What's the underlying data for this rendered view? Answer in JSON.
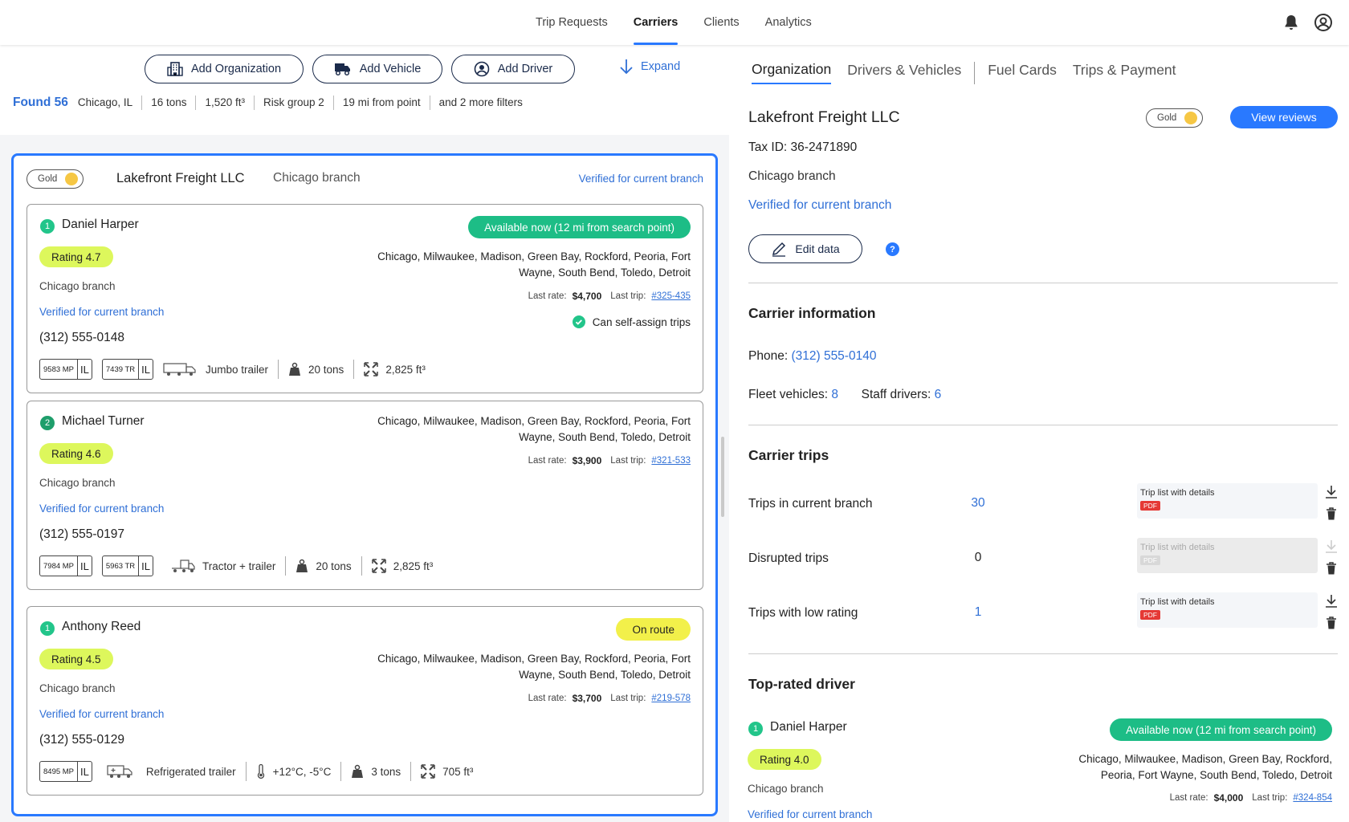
{
  "nav": {
    "items": [
      "Trip Requests",
      "Carriers",
      "Clients",
      "Analytics"
    ],
    "active": "Carriers"
  },
  "toolbar": {
    "add_org": "Add Organization",
    "add_vehicle": "Add Vehicle",
    "add_driver": "Add Driver",
    "expand": "Expand"
  },
  "filters": {
    "found": "Found 56",
    "items": [
      "Chicago, IL",
      "16 tons",
      "1,520 ft³",
      "Risk group 2",
      "19 mi from point",
      "and 2 more filters"
    ]
  },
  "card": {
    "badge": "Gold",
    "org_name": "Lakefront Freight LLC",
    "branch": "Chicago branch",
    "verified": "Verified for current branch"
  },
  "drivers": [
    {
      "num": "1",
      "name": "Daniel Harper",
      "rating": "Rating 4.7",
      "branch": "Chicago branch",
      "verified": "Verified for current branch",
      "phone": "(312) 555-0148",
      "status": "Available now (12 mi from search point)",
      "cities_1": "Chicago, Milwaukee, Madison, Green Bay, Rockford, Peoria, Fort",
      "cities_2": "Wayne, South Bend, Toledo, Detroit",
      "last_rate_label": "Last rate:",
      "last_rate": "$4,700",
      "last_trip_label": "Last trip:",
      "last_trip": "#325-435",
      "self_assign": "Can self-assign trips",
      "plate1": "9583 MP",
      "plate2": "7439 TR",
      "region": "IL",
      "vehicle": "Jumbo trailer",
      "capacity": "20 tons",
      "volume": "2,825 ft³"
    },
    {
      "num": "2",
      "name": "Michael Turner",
      "rating": "Rating 4.6",
      "branch": "Chicago branch",
      "verified": "Verified for current branch",
      "phone": "(312) 555-0197",
      "cities_1": "Chicago, Milwaukee, Madison, Green Bay, Rockford, Peoria, Fort",
      "cities_2": "Wayne, South Bend, Toledo, Detroit",
      "last_rate_label": "Last rate:",
      "last_rate": "$3,900",
      "last_trip_label": "Last trip:",
      "last_trip": "#321-533",
      "plate1": "7984 MP",
      "plate2": "5963 TR",
      "region": "IL",
      "vehicle": "Tractor + trailer",
      "capacity": "20 tons",
      "volume": "2,825 ft³"
    },
    {
      "num": "1",
      "name": "Anthony Reed",
      "rating": "Rating 4.5",
      "branch": "Chicago branch",
      "verified": "Verified for current branch",
      "phone": "(312) 555-0129",
      "status": "On route",
      "cities_1": "Chicago, Milwaukee, Madison, Green Bay, Rockford, Peoria, Fort",
      "cities_2": "Wayne, South Bend, Toledo, Detroit",
      "last_rate_label": "Last rate:",
      "last_rate": "$3,700",
      "last_trip_label": "Last trip:",
      "last_trip": "#219-578",
      "plate1": "8495 MP",
      "region": "IL",
      "vehicle": "Refrigerated trailer",
      "temp": "+12°C, -5°C",
      "capacity": "3 tons",
      "volume": "705 ft³"
    }
  ],
  "right": {
    "tabs": [
      "Organization",
      "Drivers & Vehicles",
      "Fuel Cards",
      "Trips & Payment"
    ],
    "org_name": "Lakefront Freight LLC",
    "badge": "Gold",
    "view_reviews": "View reviews",
    "tax_id": "Tax ID: 36-2471890",
    "branch": "Chicago branch",
    "verified": "Verified for current branch",
    "edit": "Edit data",
    "help": "?",
    "carrier_info": {
      "title": "Carrier information",
      "phone_label": "Phone:",
      "phone": "(312) 555-0140",
      "fleet_label": "Fleet vehicles:",
      "fleet": "8",
      "staff_label": "Staff drivers:",
      "staff": "6"
    },
    "trips": {
      "title": "Carrier trips",
      "rows": [
        {
          "label": "Trips in current branch",
          "value": "30",
          "doc": "Trip list with details",
          "fmt": "PDF"
        },
        {
          "label": "Disrupted trips",
          "value": "0",
          "doc": "Trip list with details",
          "fmt": "PDF"
        },
        {
          "label": "Trips with low rating",
          "value": "1",
          "doc": "Trip list with details",
          "fmt": "PDF"
        }
      ]
    },
    "top_driver": {
      "title": "Top-rated driver",
      "num": "1",
      "name": "Daniel Harper",
      "rating": "Rating 4.0",
      "branch": "Chicago branch",
      "verified": "Verified for current branch",
      "status": "Available now (12 mi from search point)",
      "cities_1": "Chicago, Milwaukee, Madison, Green Bay, Rockford,",
      "cities_2": "Peoria, Fort Wayne, South Bend, Toledo, Detroit",
      "last_rate_label": "Last rate:",
      "last_rate": "$4,000",
      "last_trip_label": "Last trip:",
      "last_trip": "#324-854"
    }
  },
  "colors": {
    "accent": "#2979ff",
    "link": "#2f6fd6",
    "available": "#1dbd86",
    "on_route": "#f2f04a",
    "rating": "#ddf75c",
    "gold": "#f6c744",
    "pdf": "#e53935"
  }
}
